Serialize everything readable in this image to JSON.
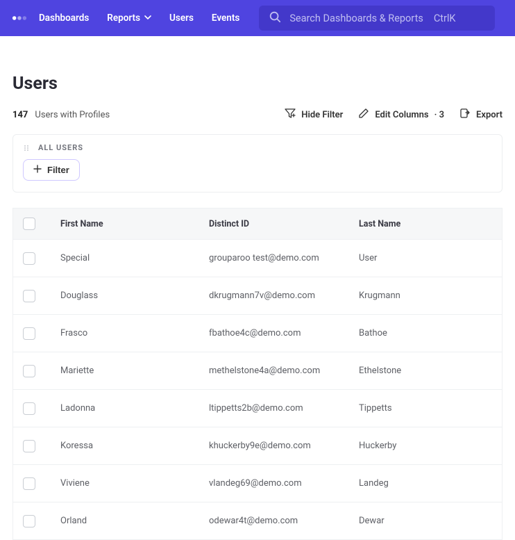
{
  "colors": {
    "primary": "#4f44e0",
    "searchBg": "#4338ca",
    "filterBtnBorder": "#cfc8ff"
  },
  "nav": {
    "items": [
      {
        "label": "Dashboards"
      },
      {
        "label": "Reports",
        "hasDropdown": true
      },
      {
        "label": "Users"
      },
      {
        "label": "Events"
      }
    ]
  },
  "search": {
    "placeholder": "Search Dashboards & Reports",
    "shortcut": "CtrlK"
  },
  "page": {
    "title": "Users",
    "count": "147",
    "countLabel": "Users with Profiles"
  },
  "toolbar": {
    "hideFilter": "Hide Filter",
    "editColumns": "Edit Columns",
    "editColumnsSuffix": "· 3",
    "export": "Export"
  },
  "filterBox": {
    "heading": "ALL USERS",
    "addFilter": "Filter"
  },
  "table": {
    "headers": {
      "first": "First Name",
      "id": "Distinct ID",
      "last": "Last Name"
    },
    "rows": [
      {
        "first": "Special",
        "id": "grouparoo test@demo.com",
        "last": "User"
      },
      {
        "first": "Douglass",
        "id": "dkrugmann7v@demo.com",
        "last": "Krugmann"
      },
      {
        "first": "Frasco",
        "id": "fbathoe4c@demo.com",
        "last": "Bathoe"
      },
      {
        "first": "Mariette",
        "id": "methelstone4a@demo.com",
        "last": "Ethelstone"
      },
      {
        "first": "Ladonna",
        "id": "ltippetts2b@demo.com",
        "last": "Tippetts"
      },
      {
        "first": "Koressa",
        "id": "khuckerby9e@demo.com",
        "last": "Huckerby"
      },
      {
        "first": "Viviene",
        "id": "vlandeg69@demo.com",
        "last": "Landeg"
      },
      {
        "first": "Orland",
        "id": "odewar4t@demo.com",
        "last": "Dewar"
      }
    ]
  }
}
